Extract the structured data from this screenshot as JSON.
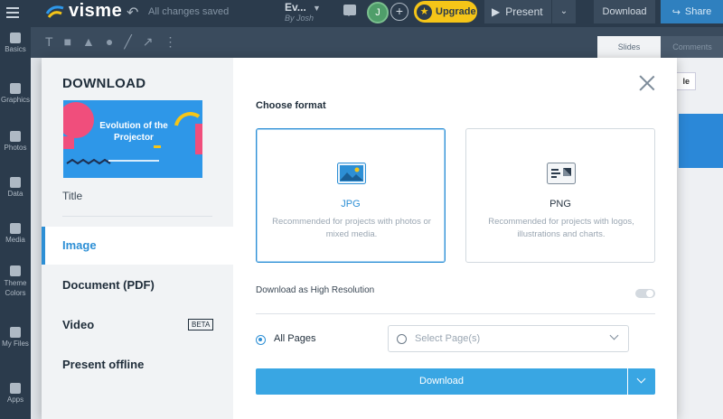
{
  "app": {
    "logo_text": "visme",
    "save_status": "All changes saved",
    "project_title": "Ev...",
    "project_author": "By Josh",
    "avatar_initial": "J",
    "add_collaborator": "+",
    "upgrade_label": "Upgrade",
    "present_label": "Present",
    "download_label": "Download",
    "share_label": "Share"
  },
  "shape_tools": [
    "T",
    "■",
    "▲",
    "●",
    "╱",
    "↗",
    "⋮"
  ],
  "right_tabs": {
    "slides": "Slides",
    "comments": "Comments"
  },
  "right_button_text": "le",
  "sidebar": {
    "items": [
      {
        "label": "Basics"
      },
      {
        "label": "Graphics"
      },
      {
        "label": "Photos"
      },
      {
        "label": "Data"
      },
      {
        "label": "Media"
      },
      {
        "label": "Theme Colors"
      },
      {
        "label": "My Files"
      },
      {
        "label": "Apps"
      }
    ]
  },
  "modal": {
    "title": "DOWNLOAD",
    "thumbnail_text": "Evolution of the Projector",
    "thumbnail_caption": "Title",
    "menu": [
      {
        "label": "Image"
      },
      {
        "label": "Document (PDF)"
      },
      {
        "label": "Video"
      },
      {
        "label": "Present offline"
      }
    ],
    "video_badge": "BETA",
    "choose_format": "Choose format",
    "formats": [
      {
        "name": "JPG",
        "description": "Recommended for projects with photos or mixed media."
      },
      {
        "name": "PNG",
        "description": "Recommended for projects with logos, illustrations and charts."
      }
    ],
    "high_res_label": "Download as High Resolution",
    "all_pages_label": "All Pages",
    "select_pages_placeholder": "Select Page(s)",
    "download_button": "Download"
  },
  "colors": {
    "accent": "#2d8fd5",
    "download_button": "#39a6e3",
    "upgrade": "#f5c518",
    "topbar": "#2b3b4c"
  }
}
